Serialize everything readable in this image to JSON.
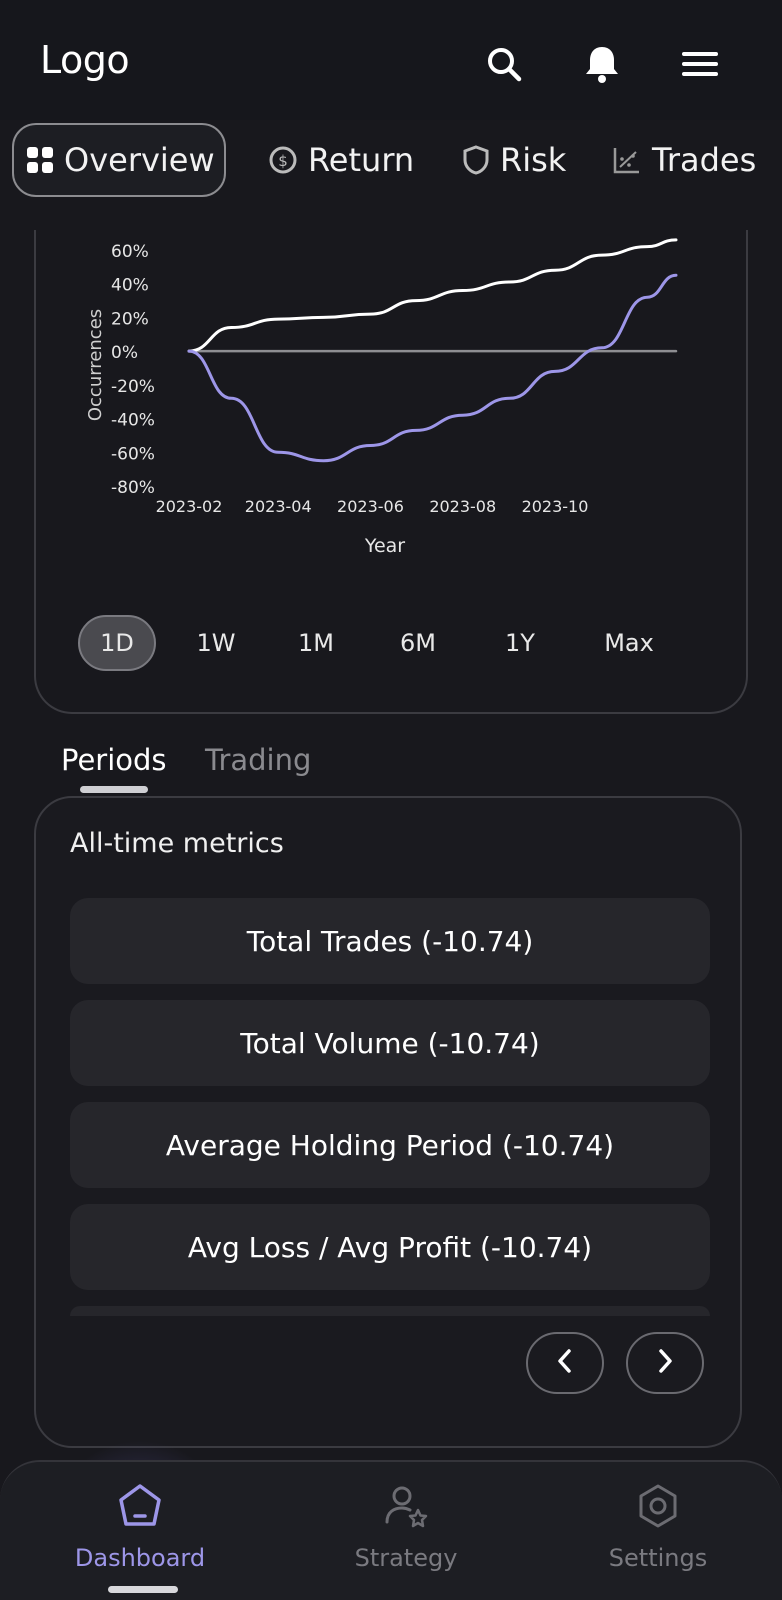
{
  "header": {
    "logo": "Logo"
  },
  "tabs": [
    {
      "label": "Overview",
      "icon": "grid-icon",
      "active": true
    },
    {
      "label": "Return",
      "icon": "coin-return-icon",
      "active": false
    },
    {
      "label": "Risk",
      "icon": "shield-icon",
      "active": false
    },
    {
      "label": "Trades",
      "icon": "scatter-chart-icon",
      "active": false
    }
  ],
  "chart_data": {
    "type": "line",
    "xlabel": "Year",
    "ylabel": "Occurrences",
    "x_ticks": [
      "2023-02",
      "2023-04",
      "2023-06",
      "2023-08",
      "2023-10"
    ],
    "y_ticks": [
      "60%",
      "40%",
      "20%",
      "0%",
      "-20%",
      "-40%",
      "-60%",
      "-80%"
    ],
    "ylim": [
      -80,
      60
    ],
    "x_dates": [
      "2023-02-01",
      "2023-03-01",
      "2023-04-01",
      "2023-05-01",
      "2023-06-01",
      "2023-07-01",
      "2023-08-01",
      "2023-09-01",
      "2023-10-01",
      "2023-11-01",
      "2023-12-01",
      "2023-12-20"
    ],
    "series": [
      {
        "color": "#ffffff",
        "values": [
          0,
          14,
          19,
          20,
          22,
          30,
          36,
          41,
          48,
          57,
          62,
          66
        ]
      },
      {
        "color": "#9d96e8",
        "values": [
          0,
          -28,
          -60,
          -65,
          -56,
          -47,
          -38,
          -28,
          -12,
          2,
          32,
          45
        ]
      },
      {
        "color": "#8e8e92",
        "values": [
          0,
          0,
          0,
          0,
          0,
          0,
          0,
          0,
          0,
          0,
          0,
          0
        ]
      }
    ],
    "grid": false
  },
  "ranges": [
    "1D",
    "1W",
    "1M",
    "6M",
    "1Y",
    "Max"
  ],
  "subtabs": {
    "periods": "Periods",
    "trading": "Trading"
  },
  "metrics": {
    "title": "All-time metrics",
    "rows": [
      "Total Trades (-10.74)",
      "Total Volume (-10.74)",
      "Average Holding Period (-10.74)",
      "Avg Loss / Avg Profit (-10.74)"
    ]
  },
  "bottom_nav": [
    {
      "label": "Dashboard",
      "icon": "home-pentagon-icon",
      "active": true
    },
    {
      "label": "Strategy",
      "icon": "user-star-icon",
      "active": false
    },
    {
      "label": "Settings",
      "icon": "hexagon-settings-icon",
      "active": false
    }
  ],
  "colors": {
    "accent": "#9d96e8",
    "background": "#18181d",
    "card": "#26262b"
  }
}
